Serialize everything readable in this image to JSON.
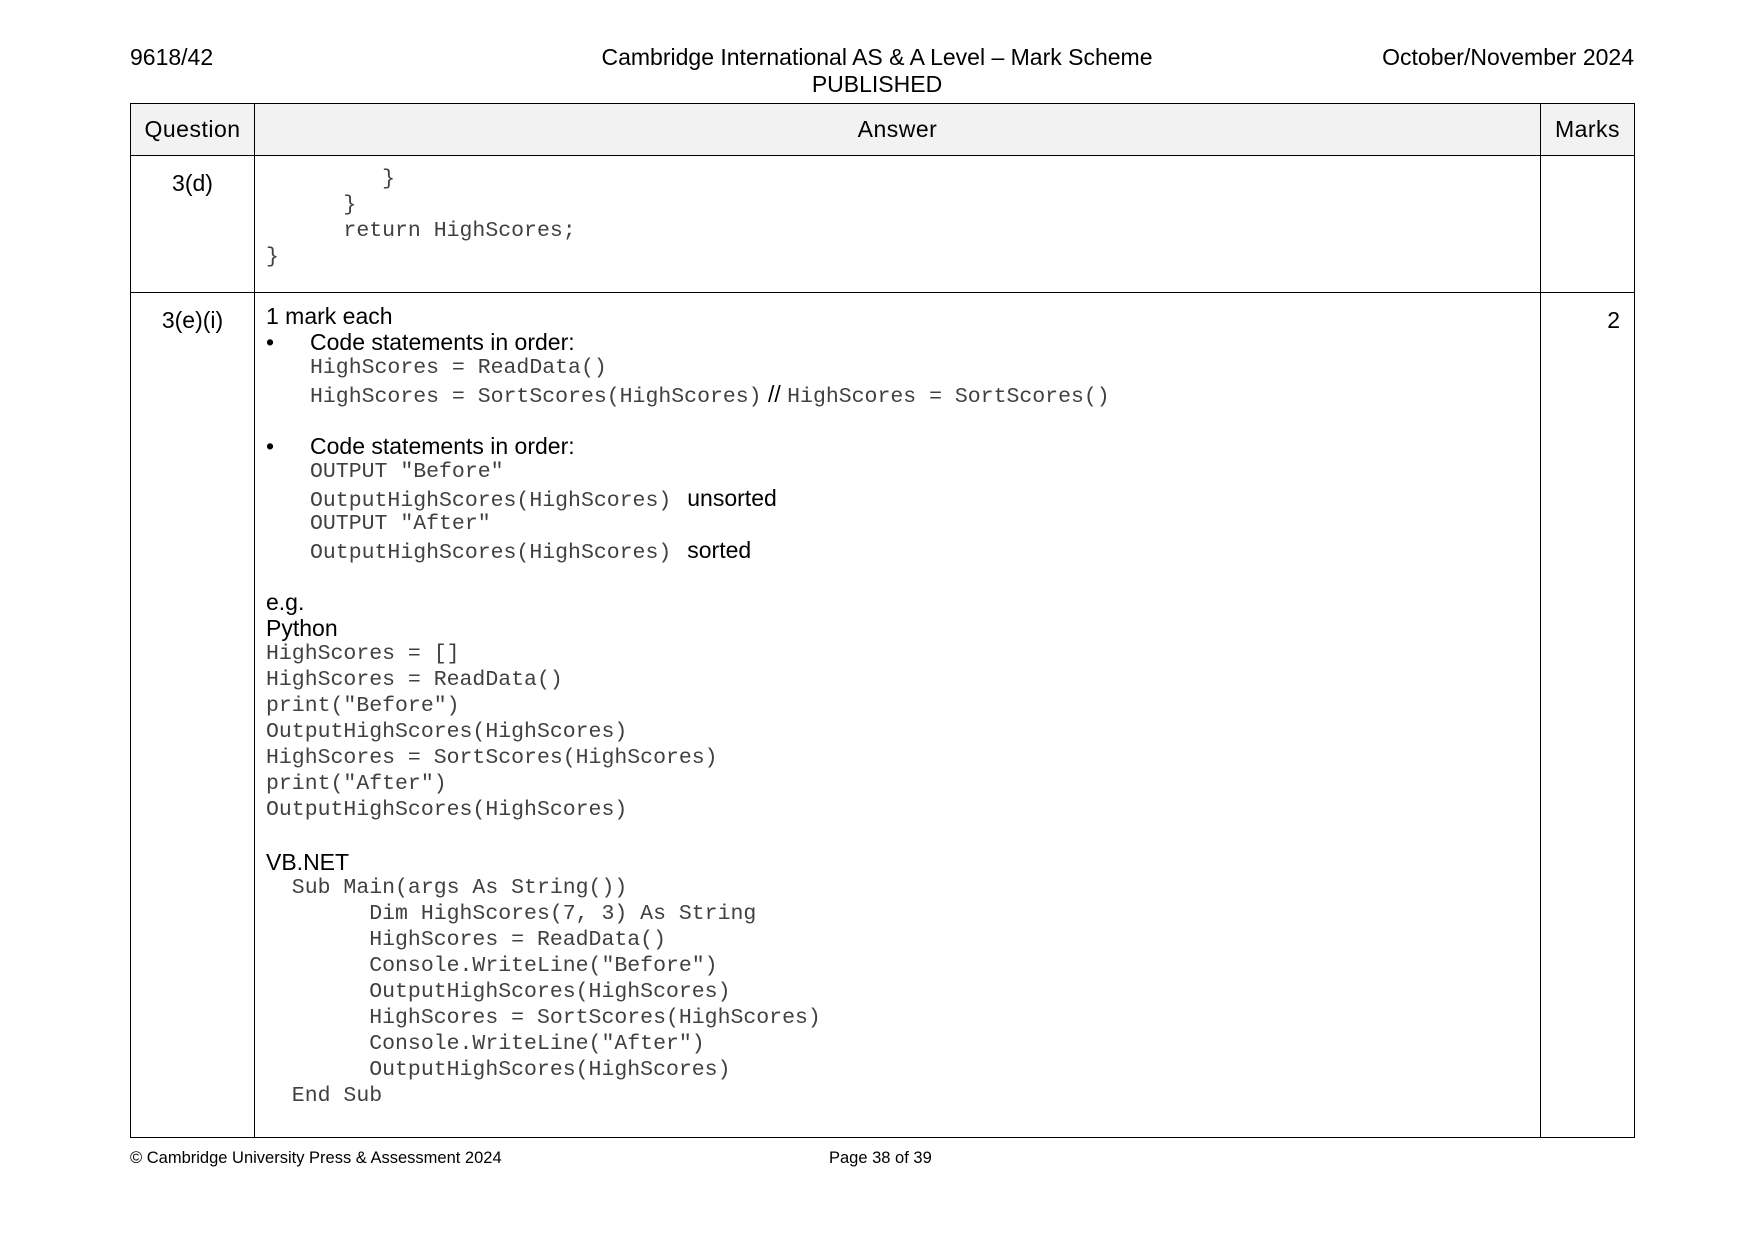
{
  "header": {
    "code": "9618/42",
    "title": "Cambridge International AS & A Level – Mark Scheme",
    "subtitle": "PUBLISHED",
    "session": "October/November 2024"
  },
  "table": {
    "columns": [
      "Question",
      "Answer",
      "Marks"
    ],
    "row1": {
      "question": "3(d)",
      "marks": "",
      "code": [
        "         }",
        "      }",
        "      return HighScores;",
        "}"
      ]
    },
    "row2": {
      "question": "3(e)(i)",
      "marks": "2",
      "intro": "1 mark each",
      "bullet1": {
        "text": "Code statements in order:",
        "line1": "HighScores = ReadData()",
        "line2_code_a": "HighScores = SortScores(HighScores)",
        "line2_sep": " // ",
        "line2_code_b": "HighScores = SortScores()"
      },
      "bullet2": {
        "text": "Code statements in order:",
        "line1": "OUTPUT \"Before\"",
        "line2_code": "OutputHighScores(HighScores)",
        "line2_note": "unsorted",
        "line3": "OUTPUT \"After\"",
        "line4_code": "OutputHighScores(HighScores)",
        "line4_note": "sorted"
      },
      "eg": "e.g.",
      "python_label": "Python",
      "python_code": [
        "HighScores = []",
        "HighScores = ReadData()",
        "print(\"Before\")",
        "OutputHighScores(HighScores)",
        "HighScores = SortScores(HighScores)",
        "print(\"After\")",
        "OutputHighScores(HighScores)"
      ],
      "vb_label": "VB.NET",
      "vb_code": [
        "  Sub Main(args As String())",
        "        Dim HighScores(7, 3) As String",
        "        HighScores = ReadData()",
        "        Console.WriteLine(\"Before\")",
        "        OutputHighScores(HighScores)",
        "        HighScores = SortScores(HighScores)",
        "        Console.WriteLine(\"After\")",
        "        OutputHighScores(HighScores)",
        "  End Sub"
      ]
    }
  },
  "footer": {
    "copyright": "© Cambridge University Press & Assessment 2024",
    "page": "Page 38 of 39"
  }
}
